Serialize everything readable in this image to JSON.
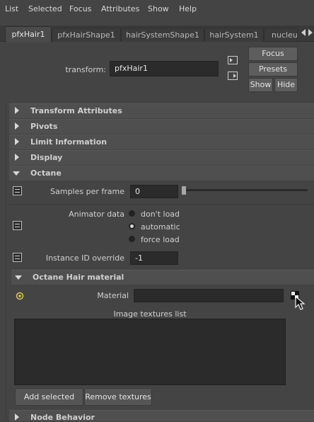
{
  "menu": [
    "List",
    "Selected",
    "Focus",
    "Attributes",
    "Show",
    "Help"
  ],
  "tabs": [
    "pfxHair1",
    "pfxHairShape1",
    "hairSystemShape1",
    "hairSystem1",
    "nucleu"
  ],
  "transform": {
    "label": "transform:",
    "value": "pfxHair1",
    "focus": "Focus",
    "presets": "Presets",
    "show": "Show",
    "hide": "Hide"
  },
  "sections": {
    "transform_attributes": "Transform Attributes",
    "pivots": "Pivots",
    "limit_information": "Limit Information",
    "display": "Display",
    "octane": "Octane",
    "octane_hair_material": "Octane Hair material",
    "node_behavior": "Node Behavior"
  },
  "octane": {
    "samples_label": "Samples per frame",
    "samples_value": "0",
    "animator_label": "Animator data",
    "animator_options": [
      "don't load",
      "automatic",
      "force load"
    ],
    "animator_selected": "automatic",
    "instance_label": "Instance ID override",
    "instance_value": "-1"
  },
  "hair_material": {
    "material_label": "Material",
    "material_value": "",
    "textures_list_label": "Image textures list",
    "add_selected": "Add selected",
    "remove_textures": "Remove textures"
  }
}
